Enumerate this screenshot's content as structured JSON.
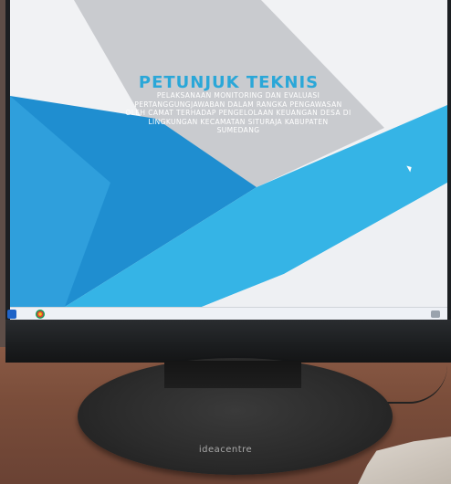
{
  "slide": {
    "title": "PETUNJUK TEKNIS",
    "subtitle_lines": [
      "PELAKSANAAN MONITORING DAN EVALUASI",
      "PERTANGGUNGJAWABAN DALAM RANGKA PENGAWASAN",
      "OLEH CAMAT TERHADAP PENGELOLAAN KEUANGAN DESA DI",
      "LINGKUNGAN KECAMATAN SITURAJA KABUPATEN",
      "SUMEDANG"
    ],
    "colors": {
      "title": "#2aa7d8",
      "blue_dark": "#1f8ed0",
      "blue_light": "#35b4e6",
      "grey_triangle": "#c9cbcf"
    }
  },
  "taskbar": {
    "icons": [
      "windows-start-icon",
      "chrome-icon"
    ]
  },
  "monitor": {
    "brand": "ideacentre"
  }
}
